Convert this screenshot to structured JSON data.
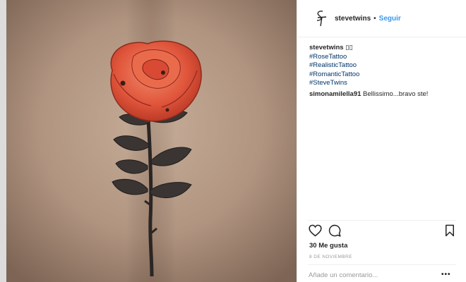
{
  "post": {
    "username": "stevetwins",
    "separator": "•",
    "follow_label": "Seguir",
    "avatar_text": "ST",
    "image_alt": "rose tattoo photo"
  },
  "caption": {
    "username": "stevetwins",
    "emoji": "▯▯",
    "hashtags": [
      "#RoseTattoo",
      "#RealisticTattoo",
      "#RomanticTattoo",
      "#SteveTwins"
    ]
  },
  "comments": [
    {
      "username": "simonamilella91",
      "text": "Bellissimo...bravo ste!"
    }
  ],
  "actions": {
    "like_icon": "heart-icon",
    "comment_icon": "comment-icon",
    "save_icon": "bookmark-icon"
  },
  "likes_text": "30 Me gusta",
  "date_text": "8 DE NOVIEMBRE",
  "comment_input": {
    "placeholder": "Añade un comentario...",
    "value": ""
  },
  "more_label": "•••",
  "colors": {
    "follow": "#3897f0",
    "hashtag": "#003569",
    "text": "#262626",
    "muted": "#999999",
    "rose": "#e0553b"
  }
}
